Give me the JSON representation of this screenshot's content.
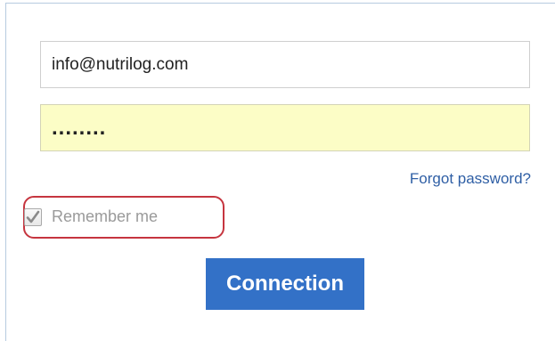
{
  "login": {
    "email_value": "info@nutrilog.com",
    "password_value": "........",
    "forgot_label": "Forgot password?",
    "remember_label": "Remember me",
    "remember_checked": true,
    "connect_label": "Connection"
  },
  "colors": {
    "accent": "#3371c7",
    "link": "#2f5fa5",
    "highlight": "#c6353f",
    "autofill": "#fcfdc6"
  },
  "icons": {
    "checkbox": "checkmark-icon"
  }
}
